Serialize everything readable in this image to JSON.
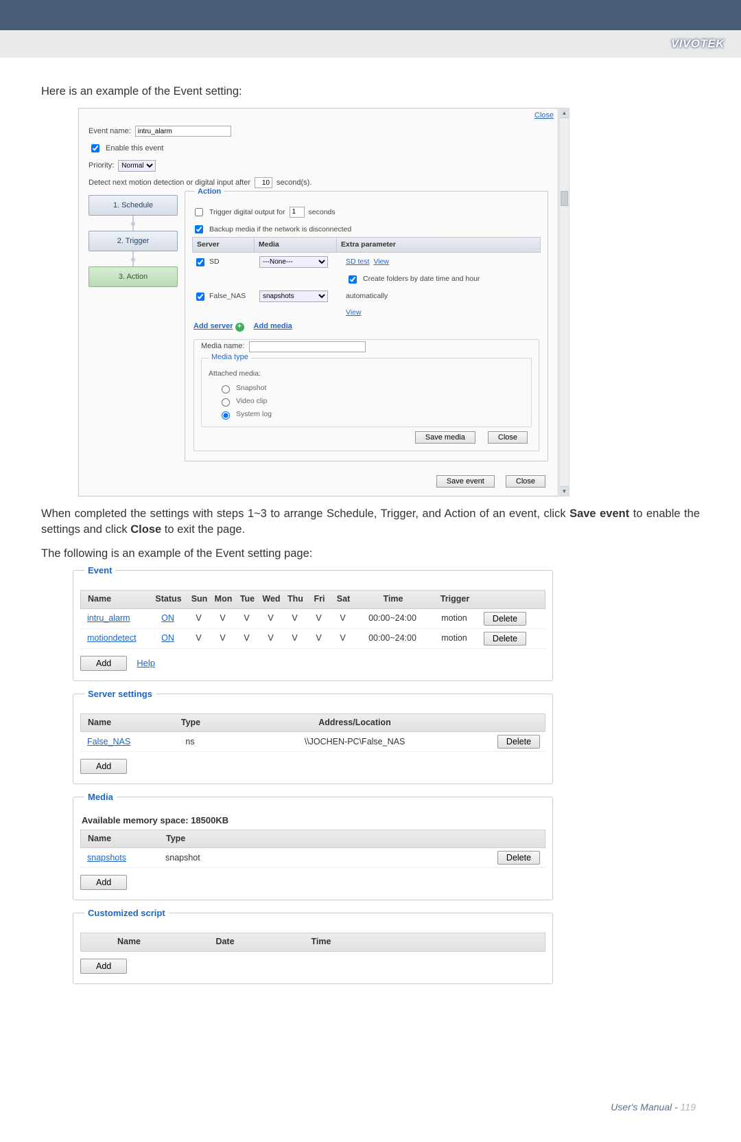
{
  "header": {
    "brand": "VIVOTEK"
  },
  "intro1": "Here is an example of the Event setting:",
  "para1_a": "When completed the settings with steps 1~3 to arrange Schedule, Trigger, and Action of an event, click ",
  "para1_b": "Save event",
  "para1_c": " to enable the settings and click ",
  "para1_d": "Close",
  "para1_e": " to exit the page.",
  "intro2": "The following is an example of the Event setting page:",
  "footer": {
    "text": "User's Manual - ",
    "page": "119"
  },
  "dialog": {
    "close": "Close",
    "event_name_label": "Event name:",
    "event_name_value": "intru_alarm",
    "enable_label": "Enable this event",
    "priority_label": "Priority:",
    "priority_value": "Normal",
    "detect_label_a": "Detect next motion detection or digital input after",
    "detect_value": "10",
    "detect_label_b": "second(s).",
    "steps": {
      "s1": "1. Schedule",
      "s2": "2. Trigger",
      "s3": "3. Action"
    },
    "action_legend": "Action",
    "trigger_do_label": "Trigger digital output for",
    "trigger_do_value": "1",
    "trigger_do_unit": "seconds",
    "backup_label": "Backup media if the network is disconnected",
    "th_server": "Server",
    "th_media": "Media",
    "th_extra": "Extra parameter",
    "row_sd": {
      "name": "SD",
      "media": "---None---",
      "sd_test": "SD test",
      "view": "View",
      "create_folders": "Create folders by date time and hour"
    },
    "row_nas": {
      "name": "False_NAS",
      "media": "snapshots",
      "auto": "automatically",
      "view": "View"
    },
    "add_server": "Add server",
    "add_media": "Add media",
    "media_name_label": "Media name:",
    "media_type_legend": "Media type",
    "attached_label": "Attached media:",
    "opt_snapshot": "Snapshot",
    "opt_video": "Video clip",
    "opt_syslog": "System log",
    "save_media": "Save media",
    "close_inner": "Close",
    "save_event": "Save event",
    "close_outer": "Close"
  },
  "eventPage": {
    "event_legend": "Event",
    "cols": {
      "name": "Name",
      "status": "Status",
      "sun": "Sun",
      "mon": "Mon",
      "tue": "Tue",
      "wed": "Wed",
      "thu": "Thu",
      "fri": "Fri",
      "sat": "Sat",
      "time": "Time",
      "trigger": "Trigger"
    },
    "rows": [
      {
        "name": "intru_alarm",
        "status": "ON",
        "days": [
          "V",
          "V",
          "V",
          "V",
          "V",
          "V",
          "V"
        ],
        "time": "00:00~24:00",
        "trigger": "motion",
        "del": "Delete"
      },
      {
        "name": "motiondetect",
        "status": "ON",
        "days": [
          "V",
          "V",
          "V",
          "V",
          "V",
          "V",
          "V"
        ],
        "time": "00:00~24:00",
        "trigger": "motion",
        "del": "Delete"
      }
    ],
    "add": "Add",
    "help": "Help",
    "server_legend": "Server settings",
    "server_cols": {
      "name": "Name",
      "type": "Type",
      "addr": "Address/Location"
    },
    "server_rows": [
      {
        "name": "False_NAS",
        "type": "ns",
        "addr": "\\\\JOCHEN-PC\\False_NAS",
        "del": "Delete"
      }
    ],
    "server_add": "Add",
    "media_legend": "Media",
    "available": "Available memory space: 18500KB",
    "media_cols": {
      "name": "Name",
      "type": "Type"
    },
    "media_rows": [
      {
        "name": "snapshots",
        "type": "snapshot",
        "del": "Delete"
      }
    ],
    "media_add": "Add",
    "script_legend": "Customized script",
    "script_cols": {
      "name": "Name",
      "date": "Date",
      "time": "Time"
    },
    "script_add": "Add"
  }
}
